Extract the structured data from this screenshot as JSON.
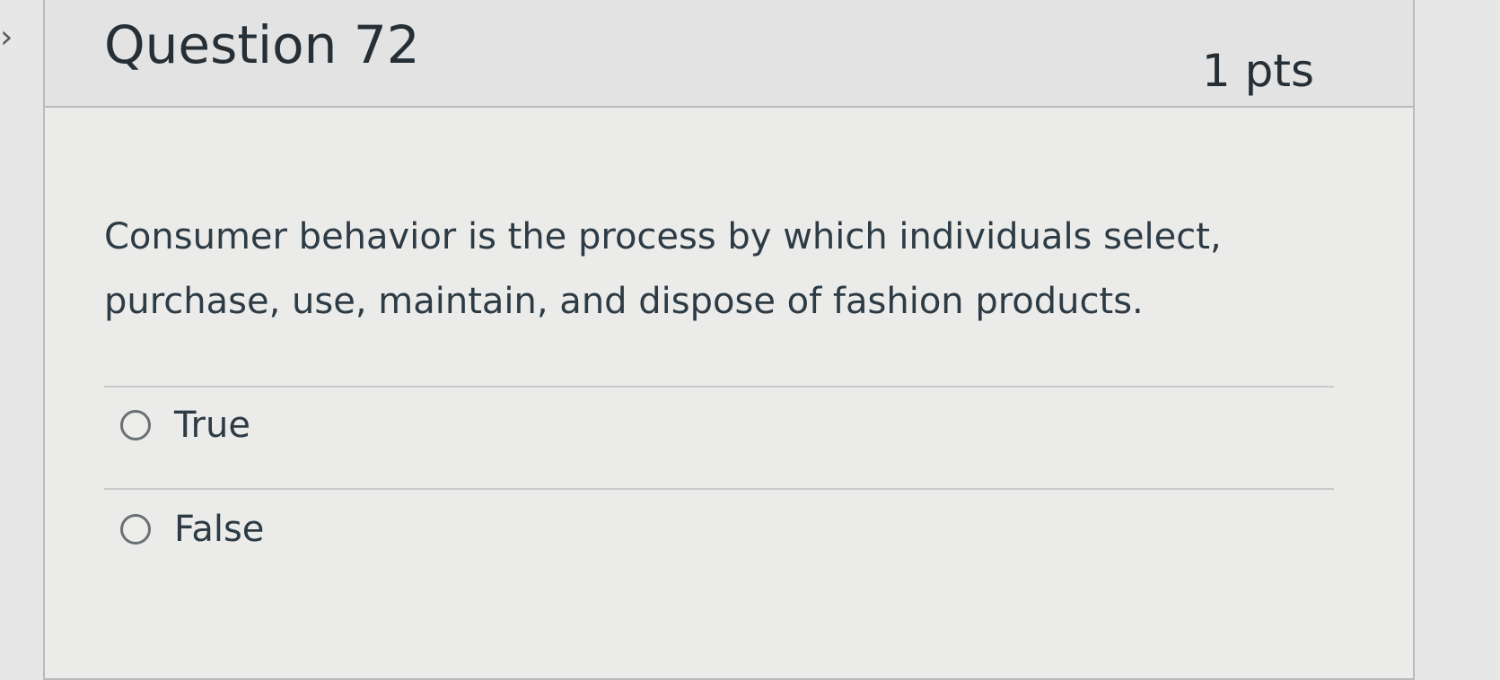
{
  "sidebar": {
    "collapse_icon": "chevron-right-icon"
  },
  "question": {
    "title": "Question 72",
    "points": "1 pts",
    "text": "Consumer behavior is the process by which individuals select, purchase, use, maintain, and dispose of fashion products.",
    "answers": [
      {
        "label": "True",
        "selected": false
      },
      {
        "label": "False",
        "selected": false
      }
    ]
  },
  "colors": {
    "background": "#e6e7e6",
    "header_background": "#e2e3e2",
    "border": "#b8bbbc",
    "text": "#2d3b45"
  }
}
